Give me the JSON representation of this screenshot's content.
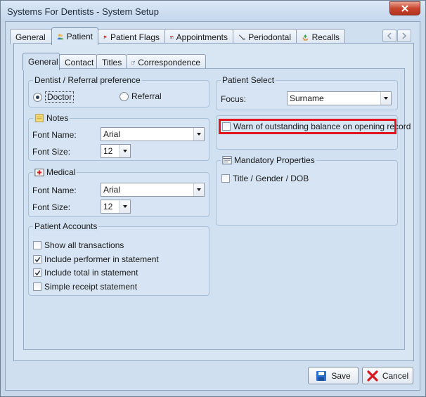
{
  "window": {
    "title": "Systems For Dentists - System Setup"
  },
  "outer_tabs": [
    {
      "label": "General",
      "icon": "none"
    },
    {
      "label": "Patient",
      "icon": "patient-icon"
    },
    {
      "label": "Patient Flags",
      "icon": "flag-icon"
    },
    {
      "label": "Appointments",
      "icon": "calendar-icon",
      "icon_text": "21"
    },
    {
      "label": "Periodontal",
      "icon": "tooth-probe-icon"
    },
    {
      "label": "Recalls",
      "icon": "recycle-icon"
    }
  ],
  "inner_tabs": [
    {
      "label": "General"
    },
    {
      "label": "Contact"
    },
    {
      "label": "Titles"
    },
    {
      "label": "Correspondence"
    }
  ],
  "dentist_referral": {
    "title": "Dentist / Referral preference",
    "options": [
      "Doctor",
      "Referral"
    ],
    "selected": "Doctor"
  },
  "notes": {
    "title": "Notes",
    "font_name_label": "Font Name:",
    "font_name_value": "Arial",
    "font_size_label": "Font Size:",
    "font_size_value": "12"
  },
  "medical": {
    "title": "Medical",
    "font_name_label": "Font Name:",
    "font_name_value": "Arial",
    "font_size_label": "Font Size:",
    "font_size_value": "12"
  },
  "patient_accounts": {
    "title": "Patient Accounts",
    "items": [
      {
        "label": "Show all transactions",
        "checked": false
      },
      {
        "label": "Include performer in statement",
        "checked": true
      },
      {
        "label": "Include total in statement",
        "checked": true
      },
      {
        "label": "Simple receipt statement",
        "checked": false
      }
    ]
  },
  "patient_select": {
    "title": "Patient Select",
    "focus_label": "Focus:",
    "focus_value": "Surname"
  },
  "warn_balance": {
    "label": "Warn of outstanding balance on opening record",
    "checked": false
  },
  "mandatory": {
    "title": "Mandatory Properties",
    "items": [
      {
        "label": "Title / Gender / DOB",
        "checked": false
      }
    ]
  },
  "buttons": {
    "save": "Save",
    "cancel": "Cancel"
  },
  "colors": {
    "highlight": "#e3141c",
    "cancel_x": "#d8161d",
    "save_icon": "#2a6fd0"
  }
}
